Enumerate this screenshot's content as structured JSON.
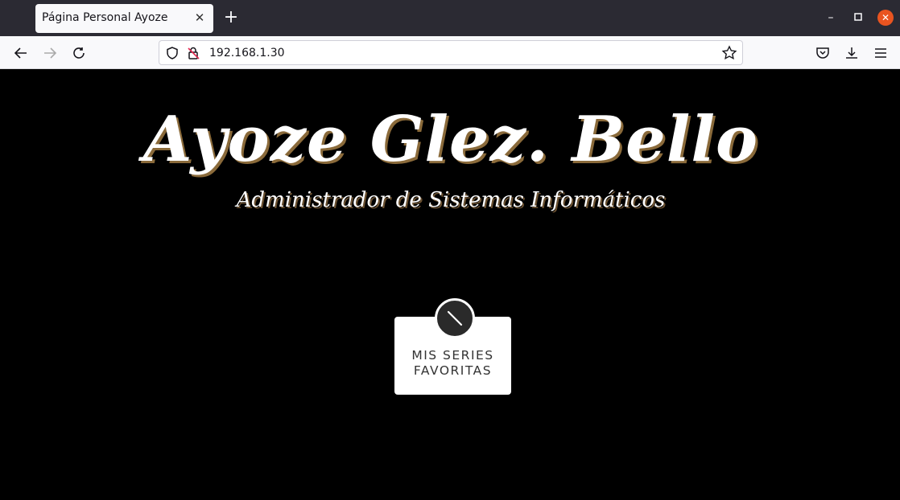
{
  "browser": {
    "tab_title": "Página Personal Ayoze",
    "tab_close_icon": "close-icon",
    "new_tab_icon": "plus-icon",
    "url": "192.168.1.30",
    "window_controls": [
      "minimize-icon",
      "maximize-icon",
      "close-icon"
    ],
    "accent_close": "#e95420"
  },
  "page": {
    "title": "Ayoze Glez. Bello",
    "subtitle": "Administrador de Sistemas Informáticos",
    "card": {
      "label_line1": "MIS SERIES",
      "label_line2": "FAVORITAS",
      "icon": "slash-circle-icon"
    },
    "background": "#000000"
  }
}
